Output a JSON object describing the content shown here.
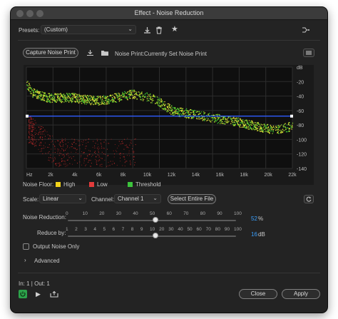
{
  "window": {
    "title": "Effect - Noise Reduction"
  },
  "presets": {
    "label": "Presets:",
    "value": "(Custom)",
    "icons": [
      "download-preset-icon",
      "delete-preset-icon",
      "favorite-star-icon"
    ],
    "right_icon": "routing-icon"
  },
  "capture": {
    "button_label": "Capture Noise Print",
    "noise_print_label": "Noise Print:",
    "noise_print_value": "Currently Set Noise Print"
  },
  "graph": {
    "db_ticks": [
      "dB",
      "-20",
      "-40",
      "-60",
      "-80",
      "-100",
      "-120",
      "-140"
    ],
    "hz_ticks": [
      "Hz",
      "2k",
      "4k",
      "6k",
      "8k",
      "10k",
      "12k",
      "14k",
      "16k",
      "18k",
      "20k",
      "22k"
    ]
  },
  "legend": {
    "label": "Noise Floor:",
    "items": [
      {
        "label": "High",
        "color": "#f2d21a"
      },
      {
        "label": "Low",
        "color": "#e23b3b"
      },
      {
        "label": "Threshold",
        "color": "#3cc33c"
      }
    ]
  },
  "scale": {
    "label": "Scale:",
    "value": "Linear"
  },
  "channel": {
    "label": "Channel:",
    "value": "Channel 1"
  },
  "select_entire_file": "Select Entire File",
  "noise_reduction": {
    "label": "Noise Reduction:",
    "ticks": [
      "0",
      "10",
      "20",
      "30",
      "40",
      "50",
      "60",
      "70",
      "80",
      "90",
      "100"
    ],
    "value": "52",
    "unit": "%",
    "fraction": 0.52
  },
  "reduce_by": {
    "label": "Reduce by:",
    "ticks": [
      "1",
      "2",
      "3",
      "4",
      "5",
      "6",
      "7",
      "8",
      "9",
      "10",
      "20",
      "30",
      "40",
      "50",
      "60",
      "70",
      "80",
      "90",
      "100"
    ],
    "value": "16",
    "unit": "dB",
    "fraction": 0.52
  },
  "output_noise_only": "Output Noise Only",
  "advanced": "Advanced",
  "io": "In: 1 | Out: 1",
  "buttons": {
    "close": "Close",
    "apply": "Apply"
  },
  "colors": {
    "accent": "#3aa0ff",
    "threshold_line": "#2f5bff",
    "power": "#2ca24a"
  }
}
